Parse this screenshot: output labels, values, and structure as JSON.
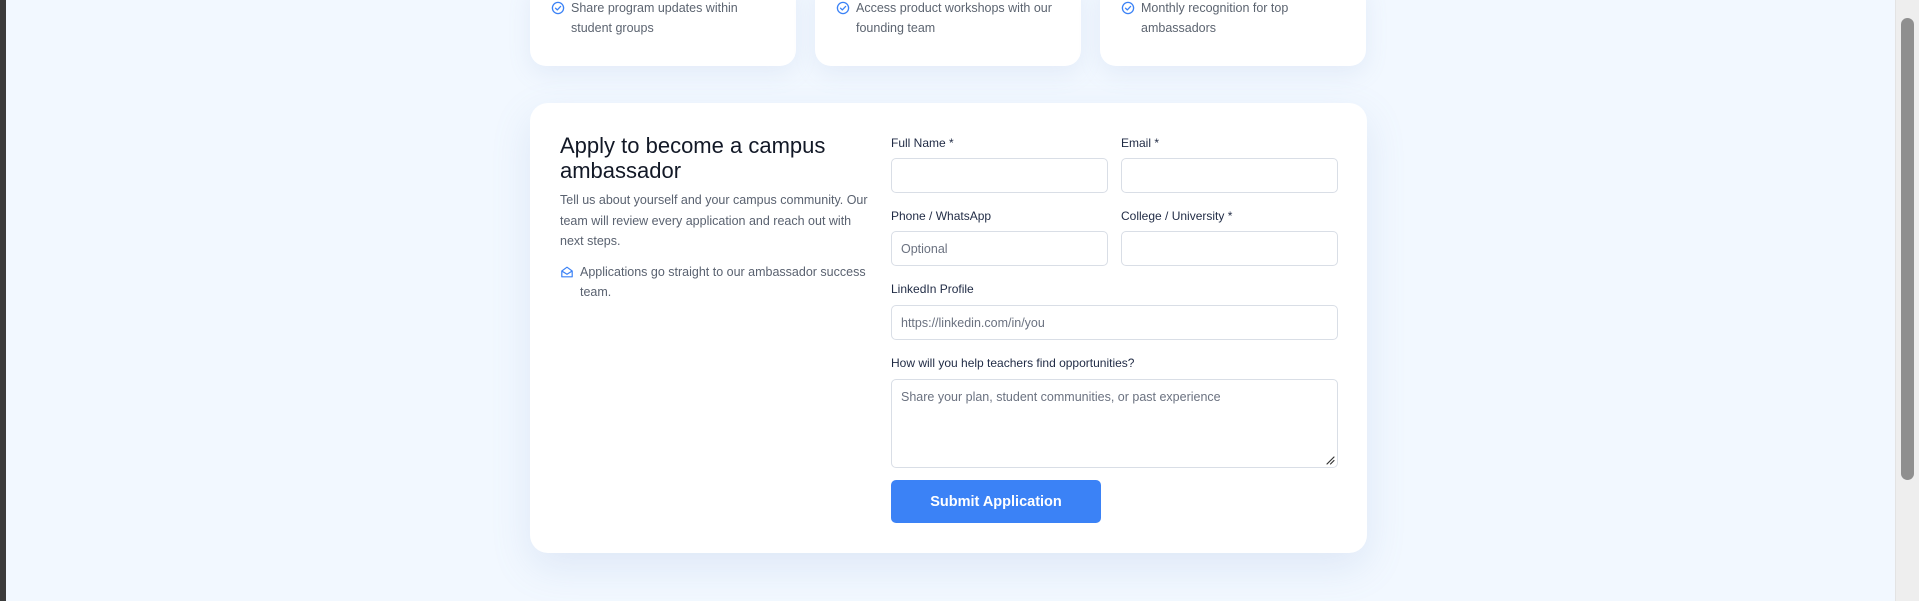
{
  "benefits": [
    {
      "text": "Share program updates within student groups"
    },
    {
      "text": "Access product workshops with our founding team"
    },
    {
      "text": "Monthly recognition for top ambassadors"
    }
  ],
  "apply": {
    "title": "Apply to become a campus ambassador",
    "description": "Tell us about yourself and your campus community. Our team will review every application and reach out with next steps.",
    "note": "Applications go straight to our ambassador success team.",
    "fields": {
      "full_name": {
        "label": "Full Name *",
        "value": "",
        "placeholder": ""
      },
      "email": {
        "label": "Email *",
        "value": "",
        "placeholder": ""
      },
      "phone": {
        "label": "Phone / WhatsApp",
        "value": "",
        "placeholder": "Optional"
      },
      "college": {
        "label": "College / University *",
        "value": "",
        "placeholder": ""
      },
      "linkedin": {
        "label": "LinkedIn Profile",
        "value": "",
        "placeholder": "https://linkedin.com/in/you"
      },
      "plan": {
        "label": "How will you help teachers find opportunities?",
        "value": "",
        "placeholder": "Share your plan, student communities, or past experience"
      }
    },
    "submit_label": "Submit Application"
  },
  "icons": {
    "benefit": "check-circle-icon",
    "note": "mail-open-icon"
  },
  "colors": {
    "accent": "#3b82f6",
    "page_background": "#f2f8ff",
    "card_background": "#ffffff"
  }
}
